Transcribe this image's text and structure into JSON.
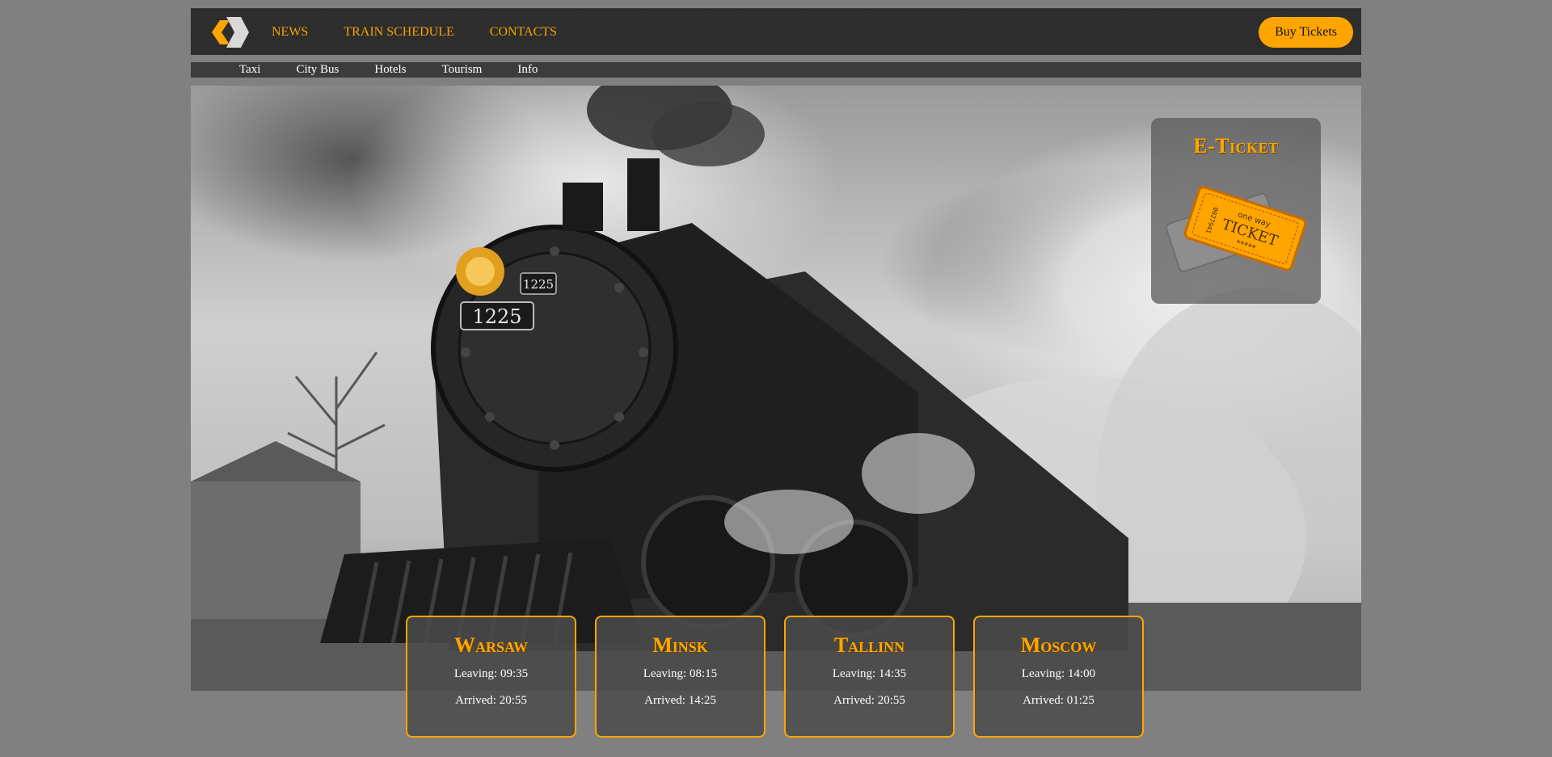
{
  "header": {
    "logo_icon": "chevron-logo-icon",
    "nav": [
      "NEWS",
      "TRAIN SCHEDULE",
      "CONTACTS"
    ],
    "buy_label": "Buy Tickets"
  },
  "subnav": [
    "Taxi",
    "City Bus",
    "Hotels",
    "Tourism",
    "Info"
  ],
  "hero": {
    "locomotive_number": "1225",
    "eticket": {
      "title": "E-Ticket",
      "ticket_top": "one way",
      "ticket_main": "TICKET",
      "ticket_stars": "*****",
      "ticket_serial": "0027941"
    }
  },
  "destinations": [
    {
      "city": "Warsaw",
      "leaving": "Leaving: 09:35",
      "arrived": "Arrived: 20:55"
    },
    {
      "city": "Minsk",
      "leaving": "Leaving: 08:15",
      "arrived": "Arrived: 14:25"
    },
    {
      "city": "Tallinn",
      "leaving": "Leaving: 14:35",
      "arrived": "Arrived: 20:55"
    },
    {
      "city": "Moscow",
      "leaving": "Leaving: 14:00",
      "arrived": "Arrived: 01:25"
    }
  ],
  "colors": {
    "accent": "#ffa500",
    "page_bg": "#808080",
    "header_bg": "#2b2b2b"
  }
}
